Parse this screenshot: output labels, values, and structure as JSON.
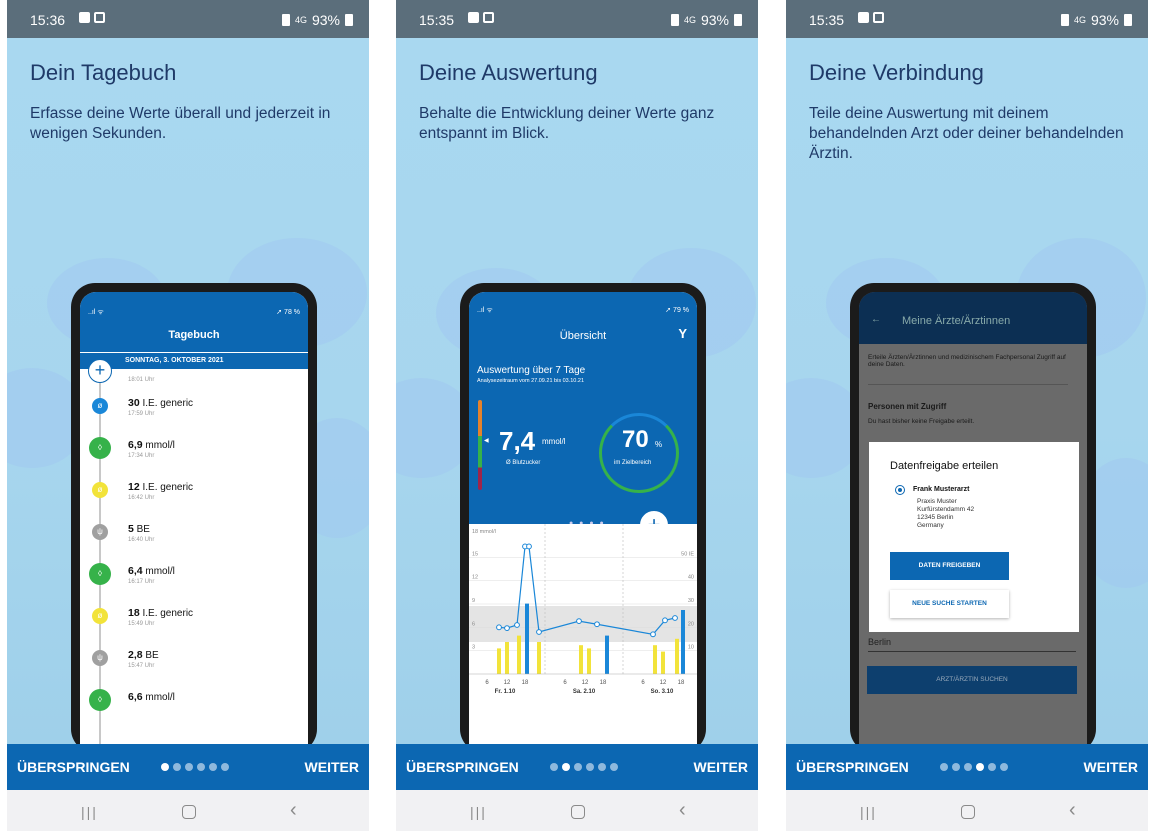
{
  "screens": [
    {
      "status": {
        "time": "15:36",
        "battery": "93%",
        "signal": "4G"
      },
      "title": "Dein Tagebuch",
      "description": "Erfasse deine Werte überall und jederzeit in wenigen Sekunden.",
      "phone": {
        "status_left": "..ıl ᯤ",
        "status_right": "➚ 78 %",
        "header": "Tagebuch",
        "date": "SONNTAG, 3. OKTOBER 2021",
        "first_time": "18:01 Uhr",
        "entries": [
          {
            "value": "30",
            "unit": "I.E. generic",
            "time": "17:59 Uhr",
            "color": "#1a87d8",
            "icon": "syringe-icon"
          },
          {
            "value": "6,9",
            "unit": "mmol/l",
            "time": "17:34 Uhr",
            "color": "#36b24a",
            "icon": "drop-icon"
          },
          {
            "value": "12",
            "unit": "I.E. generic",
            "time": "16:42 Uhr",
            "color": "#f2e33a",
            "icon": "syringe-icon"
          },
          {
            "value": "5",
            "unit": "BE",
            "time": "16:40 Uhr",
            "color": "#a0a0a0",
            "icon": "fork-knife-icon"
          },
          {
            "value": "6,4",
            "unit": "mmol/l",
            "time": "16:17 Uhr",
            "color": "#36b24a",
            "icon": "drop-icon"
          },
          {
            "value": "18",
            "unit": "I.E. generic",
            "time": "15:49 Uhr",
            "color": "#f2e33a",
            "icon": "syringe-icon"
          },
          {
            "value": "2,8",
            "unit": "BE",
            "time": "15:47 Uhr",
            "color": "#a0a0a0",
            "icon": "fork-knife-icon"
          },
          {
            "value": "6,6",
            "unit": "mmol/l",
            "time": "",
            "color": "#36b24a",
            "icon": "drop-icon"
          }
        ]
      },
      "page_index": 0
    },
    {
      "status": {
        "time": "15:35",
        "battery": "93%",
        "signal": "4G"
      },
      "title": "Deine Auswertung",
      "description": "Behalte die Entwicklung deiner Werte ganz entspannt im Blick.",
      "phone": {
        "status_left": "..ıl ᯤ",
        "status_right": "➚ 79 %",
        "header": "Übersicht",
        "heading": "Auswertung über 7 Tage",
        "range": "Analysezeitraum vom 27.09.21 bis 03.10.21",
        "avg_value": "7,4",
        "avg_unit": "mmol/l",
        "avg_label": "Ø Blutzucker",
        "pct_value": "70",
        "pct_unit": "%",
        "pct_label": "im Zielbereich",
        "pager_dots": "● ● ● ●",
        "chart_axis": "18 mmol/l",
        "chart_left_ticks": [
          "15",
          "12",
          "9",
          "6",
          "3"
        ],
        "chart_right_ticks": [
          "50 IE",
          "40",
          "30",
          "20",
          "10"
        ],
        "chart_hours": [
          "6",
          "12",
          "18",
          "6",
          "12",
          "18",
          "6",
          "12",
          "18"
        ],
        "chart_days": [
          "Fr. 1.10",
          "Sa. 2.10",
          "So. 3.10"
        ]
      },
      "page_index": 1
    },
    {
      "status": {
        "time": "15:35",
        "battery": "93%",
        "signal": "4G"
      },
      "title": "Deine Verbindung",
      "description": "Teile deine Auswertung mit deinem behandelnden Arzt oder deiner behandelnden Ärztin.",
      "phone": {
        "back": "←",
        "header": "Meine Ärzte/Ärztinnen",
        "intro": "Erteile Ärzten/Ärztinnen und medizinischem Fachpersonal Zugriff auf deine Daten.",
        "access_title": "Personen mit Zugriff",
        "access_text": "Du hast bisher keine Freigabe erteilt.",
        "dialog_title": "Datenfreigabe erteilen",
        "doctor_name": "Frank Musterarzt",
        "addr1": "Praxis Muster",
        "addr2": "Kurfürstendamm 42",
        "addr3": "12345 Berlin",
        "addr4": "Germany",
        "btn_share": "DATEN FREIGEBEN",
        "btn_new": "NEUE SUCHE STARTEN",
        "city": "Berlin",
        "btn_search": "ARZT/ÄRZTIN SUCHEN"
      },
      "page_index": 3
    }
  ],
  "nav": {
    "skip": "ÜBERSPRINGEN",
    "next": "WEITER"
  },
  "colors": {
    "brand": "#0c67b2",
    "background": "#a9d8f0",
    "title": "#1f3a68"
  }
}
